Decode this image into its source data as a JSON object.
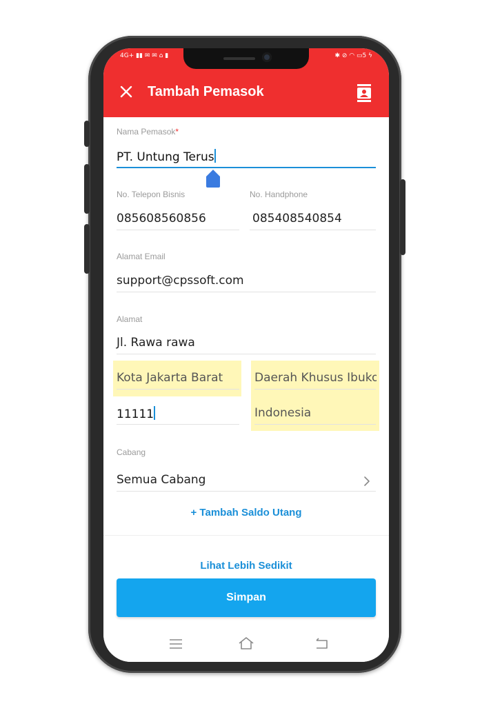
{
  "status_bar": {
    "left": "4G+ ▮▮ ✉ ✉ ⌂ ▮",
    "right": "✱ ⊘ ◠ ▭5 ϟ"
  },
  "header": {
    "title": "Tambah Pemasok"
  },
  "form": {
    "supplier_name": {
      "label": "Nama Pemasok",
      "required_mark": "*",
      "value": "PT. Untung Terus"
    },
    "business_phone": {
      "label": "No. Telepon Bisnis",
      "value": "085608560856"
    },
    "mobile_phone": {
      "label": "No. Handphone",
      "value": "085408540854"
    },
    "email": {
      "label": "Alamat Email",
      "value": "support@cpssoft.com"
    },
    "address": {
      "label": "Alamat",
      "street": "Jl. Rawa rawa",
      "city": "Kota Jakarta Barat",
      "province": "Daerah Khusus Ibukota",
      "postal_code": "11111",
      "country": "Indonesia"
    },
    "branch": {
      "label": "Cabang",
      "value": "Semua Cabang"
    }
  },
  "links": {
    "add_debt_balance": "+ Tambah Saldo Utang",
    "show_less": "Lihat Lebih Sedikit"
  },
  "buttons": {
    "save": "Simpan"
  },
  "colors": {
    "header": "#ef2f2f",
    "accent": "#14a5ee",
    "link": "#1a8fd8",
    "highlight": "#fff7b8"
  }
}
